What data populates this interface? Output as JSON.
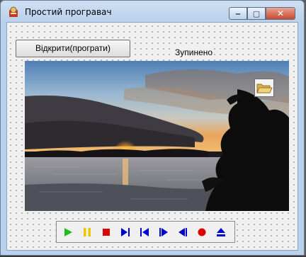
{
  "window": {
    "title": "Простий програвач",
    "controls": {
      "minimize": "‒",
      "maximize": "▢",
      "close": "✕"
    }
  },
  "player": {
    "open_button_label": "Відкрити(програти)",
    "status": "Зупинено"
  },
  "toolbar": {
    "buttons": [
      {
        "name": "play",
        "icon": "play-icon",
        "color": "#22bb22"
      },
      {
        "name": "pause",
        "icon": "pause-icon",
        "color": "#e6c800"
      },
      {
        "name": "stop",
        "icon": "stop-icon",
        "color": "#dd0000"
      },
      {
        "name": "next-track",
        "icon": "skip-next-icon",
        "color": "#0000cc"
      },
      {
        "name": "previous-track",
        "icon": "skip-previous-icon",
        "color": "#0000cc"
      },
      {
        "name": "fast-forward",
        "icon": "fast-forward-icon",
        "color": "#0000cc"
      },
      {
        "name": "rewind",
        "icon": "rewind-icon",
        "color": "#0000cc"
      },
      {
        "name": "record",
        "icon": "record-icon",
        "color": "#dd0000"
      },
      {
        "name": "eject",
        "icon": "eject-icon",
        "color": "#0000cc"
      }
    ]
  },
  "icons": {
    "app": "media-player-icon",
    "folder": "open-folder-icon"
  }
}
